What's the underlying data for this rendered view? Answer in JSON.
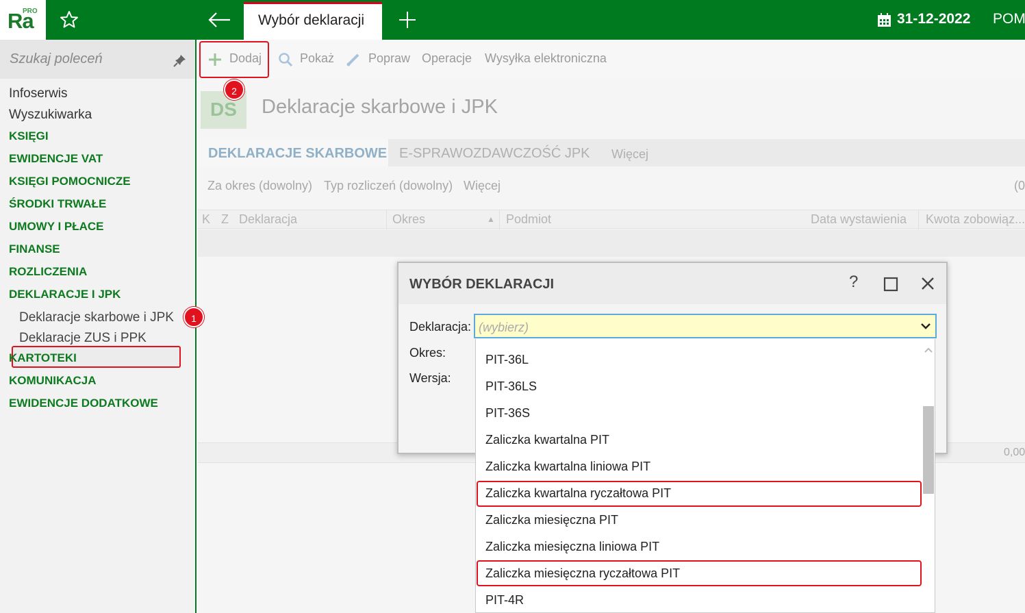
{
  "topbar": {
    "logo": "Ra",
    "logo_badge": "PRO",
    "active_tab": "Wybór deklaracji",
    "date": "31-12-2022",
    "help_label": "POM",
    "accent": "#007a1f"
  },
  "sidebar": {
    "search_placeholder": "Szukaj poleceń",
    "items": [
      {
        "label": "Infoserwis"
      },
      {
        "label": "Wyszukiwarka"
      },
      {
        "label": "KSIĘGI"
      },
      {
        "label": "EWIDENCJE VAT"
      },
      {
        "label": "KSIĘGI POMOCNICZE"
      },
      {
        "label": "ŚRODKI TRWAŁE"
      },
      {
        "label": "UMOWY I PŁACE"
      },
      {
        "label": "FINANSE"
      },
      {
        "label": "ROZLICZENIA"
      },
      {
        "label": "DEKLARACJE I JPK"
      },
      {
        "label": "Deklaracje skarbowe i JPK"
      },
      {
        "label": "Deklaracje ZUS i PPK"
      },
      {
        "label": "KARTOTEKI"
      },
      {
        "label": "KOMUNIKACJA"
      },
      {
        "label": "EWIDENCJE DODATKOWE"
      }
    ]
  },
  "toolbar": {
    "add": "Dodaj",
    "show": "Pokaż",
    "fix": "Popraw",
    "operations": "Operacje",
    "send": "Wysyłka elektroniczna"
  },
  "page": {
    "badge": "DS",
    "title": "Deklaracje skarbowe i JPK",
    "tabs": [
      "DEKLARACJE SKARBOWE",
      "E-SPRAWOZDAWCZOŚĆ JPK",
      "Więcej"
    ],
    "filters": [
      "Za okres (dowolny)",
      "Typ rozliczeń (dowolny)",
      "Więcej",
      "(0"
    ],
    "columns": [
      "K",
      "Z",
      "Deklaracja",
      "Okres",
      "Podmiot",
      "Data wystawienia",
      "Kwota zobowiąz..."
    ],
    "footer_value": "0,00"
  },
  "annotations": {
    "step1": "1",
    "step2": "2",
    "highlight_color": "#e2111e"
  },
  "dialog": {
    "title": "WYBÓR DEKLARACJI",
    "help": "?",
    "labels": {
      "deklaracja": "Deklaracja:",
      "okres": "Okres:",
      "wersja": "Wersja:"
    },
    "combo_placeholder": "(wybierz)",
    "options": [
      "PIT-36L",
      "PIT-36LS",
      "PIT-36S",
      "Zaliczka kwartalna PIT",
      "Zaliczka kwartalna liniowa PIT",
      "Zaliczka kwartalna ryczałtowa PIT",
      "Zaliczka miesięczna PIT",
      "Zaliczka miesięczna liniowa PIT",
      "Zaliczka miesięczna ryczałtowa PIT",
      "PIT-4R"
    ]
  }
}
